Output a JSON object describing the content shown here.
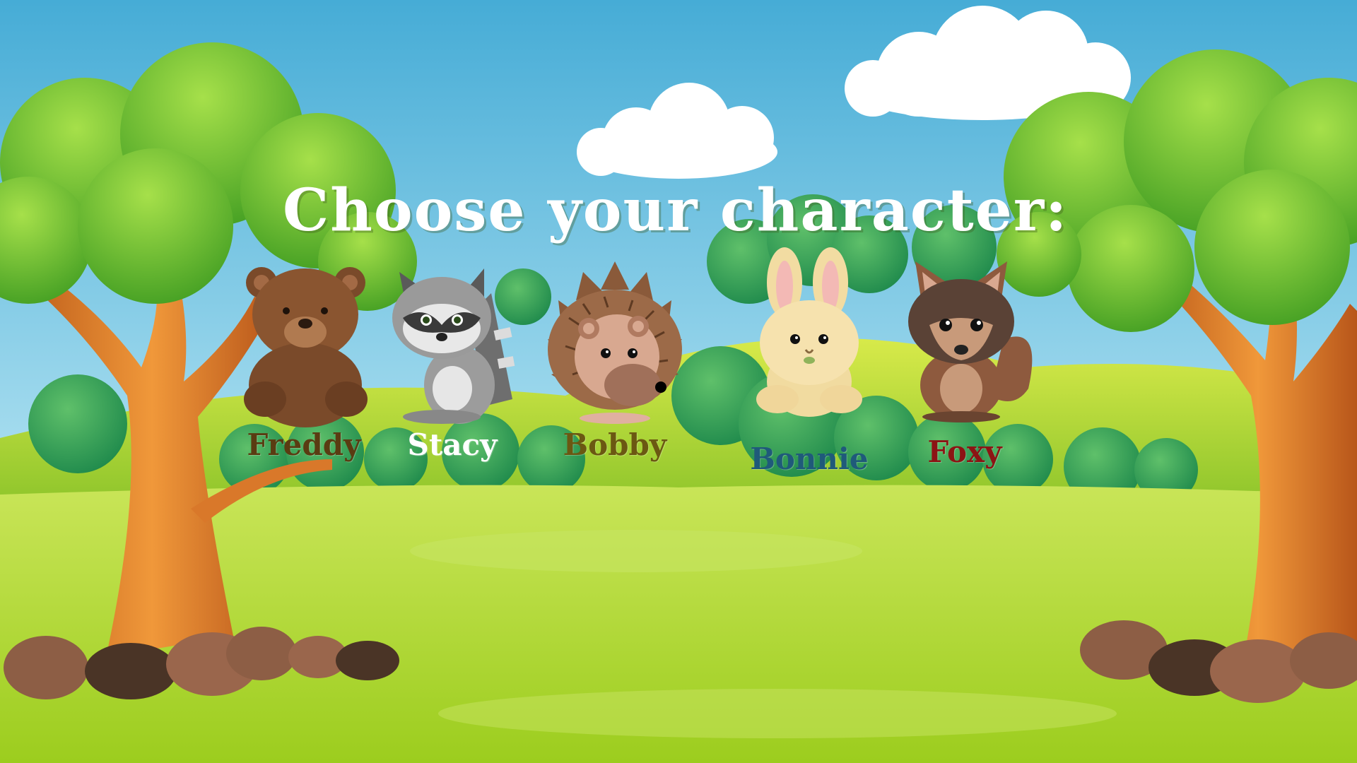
{
  "title": "Choose your character:",
  "colors": {
    "sky_top": "#4fb3d9",
    "sky_bottom": "#a9dff0",
    "grass": "#b5dc3a",
    "tree_trunk": "#d9782a",
    "foliage": "#6cc02c",
    "title_text": "#ffffff"
  },
  "characters": [
    {
      "name": "Freddy",
      "animal": "bear",
      "label_color": "#5a3c12"
    },
    {
      "name": "Stacy",
      "animal": "raccoon",
      "label_color": "#ffffff"
    },
    {
      "name": "Bobby",
      "animal": "hedgehog",
      "label_color": "#6b5812"
    },
    {
      "name": "Bonnie",
      "animal": "rabbit",
      "label_color": "#1f5a7a"
    },
    {
      "name": "Foxy",
      "animal": "fox",
      "label_color": "#8c1414"
    }
  ]
}
